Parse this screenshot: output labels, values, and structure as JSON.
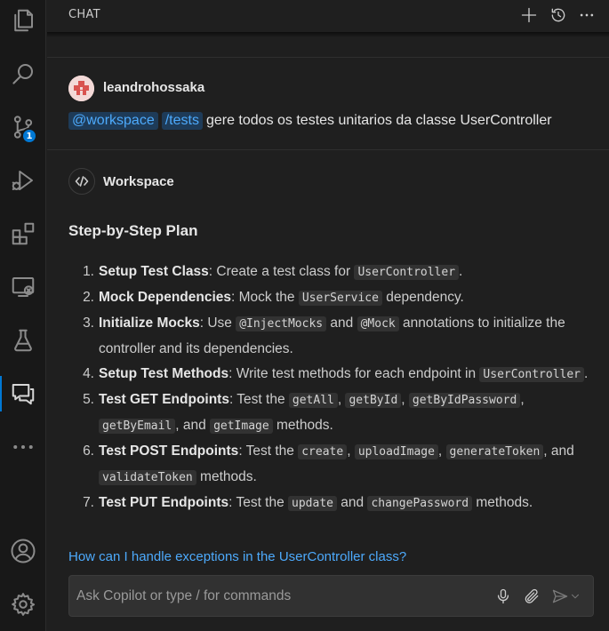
{
  "header": {
    "title": "CHAT"
  },
  "activity_bar": {
    "source_control_badge": "1"
  },
  "user_message": {
    "username": "leandrohossaka",
    "chips": [
      "@workspace",
      "/tests"
    ],
    "text": "gere todos os testes unitarios da classe UserController"
  },
  "response": {
    "agent_name": "Workspace",
    "plan_title": "Step-by-Step Plan",
    "steps": [
      {
        "num": "1.",
        "title": "Setup Test Class",
        "parts": [
          ": Create a test class for ",
          "UserController",
          "."
        ]
      },
      {
        "num": "2.",
        "title": "Mock Dependencies",
        "parts": [
          ": Mock the ",
          "UserService",
          " dependency."
        ]
      },
      {
        "num": "3.",
        "title": "Initialize Mocks",
        "parts": [
          ": Use ",
          "@InjectMocks",
          " and ",
          "@Mock",
          " annotations to initialize the controller and its dependencies."
        ]
      },
      {
        "num": "4.",
        "title": "Setup Test Methods",
        "parts": [
          ": Write test methods for each endpoint in ",
          "UserController",
          "."
        ]
      },
      {
        "num": "5.",
        "title": "Test GET Endpoints",
        "parts": [
          ": Test the ",
          "getAll",
          ", ",
          "getById",
          ", ",
          "getByIdPassword",
          ", ",
          "getByEmail",
          ", and ",
          "getImage",
          " methods."
        ]
      },
      {
        "num": "6.",
        "title": "Test POST Endpoints",
        "parts": [
          ": Test the ",
          "create",
          ", ",
          "uploadImage",
          ", ",
          "generateToken",
          ", and ",
          "validateToken",
          " methods."
        ]
      },
      {
        "num": "7.",
        "title": "Test PUT Endpoints",
        "parts": [
          ": Test the ",
          "update",
          " and ",
          "changePassword",
          " methods."
        ]
      }
    ]
  },
  "suggestion": "How can I handle exceptions in the UserController class?",
  "input": {
    "placeholder": "Ask Copilot or type / for commands"
  },
  "colors": {
    "accent": "#0078d4",
    "link": "#4daafc",
    "background": "#1f1f1f"
  }
}
